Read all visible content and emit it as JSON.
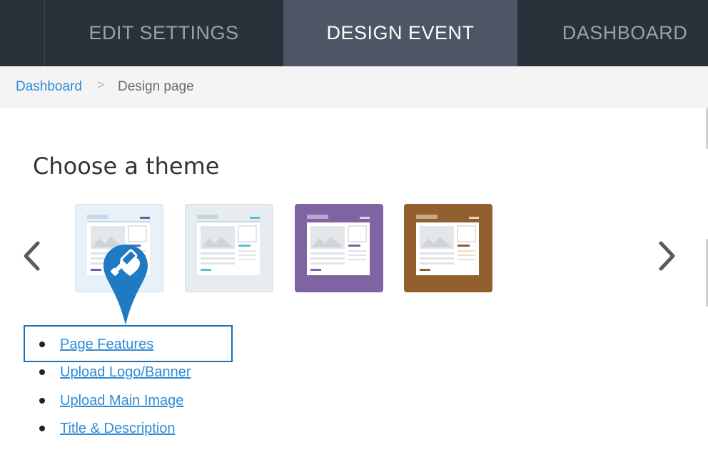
{
  "nav": {
    "tabs": [
      {
        "label": "EDIT SETTINGS"
      },
      {
        "label": "DESIGN EVENT",
        "active": true
      },
      {
        "label": "DASHBOARD"
      }
    ]
  },
  "breadcrumb": {
    "link": "Dashboard",
    "separator": ">",
    "current": "Design page"
  },
  "theme_section": {
    "heading": "Choose a theme",
    "prev_icon": "chevron-left-icon",
    "next_icon": "chevron-right-icon",
    "themes": [
      {
        "name": "light-blue",
        "bg": "#e8f1f8",
        "accent": "#5a6aa5",
        "selected": true
      },
      {
        "name": "gray",
        "bg": "#e6ecef",
        "accent": "#5bc0d6"
      },
      {
        "name": "purple",
        "bg": "#7f64a3",
        "accent": "#7f64a3"
      },
      {
        "name": "brown",
        "bg": "#925f2e",
        "accent": "#925f2e"
      }
    ],
    "marker_icon": "paint-brush-pin-icon"
  },
  "links": [
    "Page Features",
    "Upload Logo/Banner",
    "Upload Main Image",
    "Title & Description"
  ],
  "colors": {
    "nav_bg": "#2b313a",
    "nav_active": "#4d5665",
    "link": "#2f8bd6",
    "marker": "#1f7ac2"
  }
}
